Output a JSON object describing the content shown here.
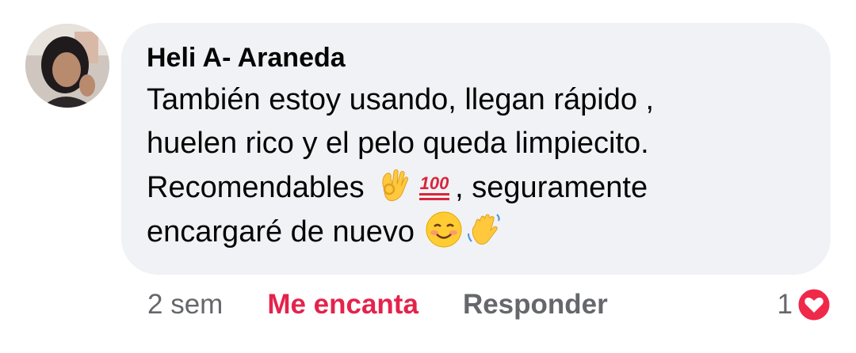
{
  "comment": {
    "author": "Heli A- Araneda",
    "lines": [
      "También estoy usando, llegan rápido ,",
      "huelen rico y el pelo queda limpiecito.",
      "Recomendables",
      ", seguramente",
      "encargaré de nuevo"
    ],
    "emojis": [
      "ok-hand-emoji",
      "hundred-points-emoji",
      "smiling-face-emoji",
      "waving-hand-emoji"
    ]
  },
  "actions": {
    "time": "2 sem",
    "react_label": "Me encanta",
    "reply_label": "Responder"
  },
  "reactions": {
    "count": "1",
    "type": "love-icon"
  },
  "colors": {
    "bubble": "#f0f2f5",
    "love_accent": "#e4234b",
    "secondary_text": "#65676b"
  }
}
